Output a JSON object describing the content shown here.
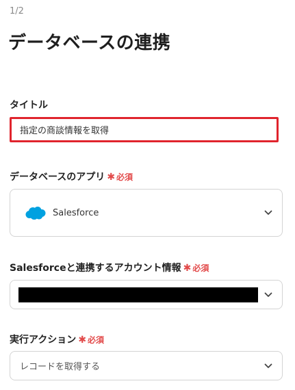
{
  "step": "1/2",
  "page_title": "データベースの連携",
  "required_text": "必須",
  "title_field": {
    "label": "タイトル",
    "value": "指定の商談情報を取得"
  },
  "app_field": {
    "label": "データベースのアプリ",
    "value": "Salesforce",
    "icon": "salesforce-cloud-icon"
  },
  "account_field": {
    "label": "Salesforceと連携するアカウント情報",
    "value_redacted": true
  },
  "action_field": {
    "label": "実行アクション",
    "value": "レコードを取得する"
  },
  "colors": {
    "accent_red": "#e0242d",
    "required_red": "#e24a4a",
    "salesforce_blue": "#00a1e0"
  }
}
